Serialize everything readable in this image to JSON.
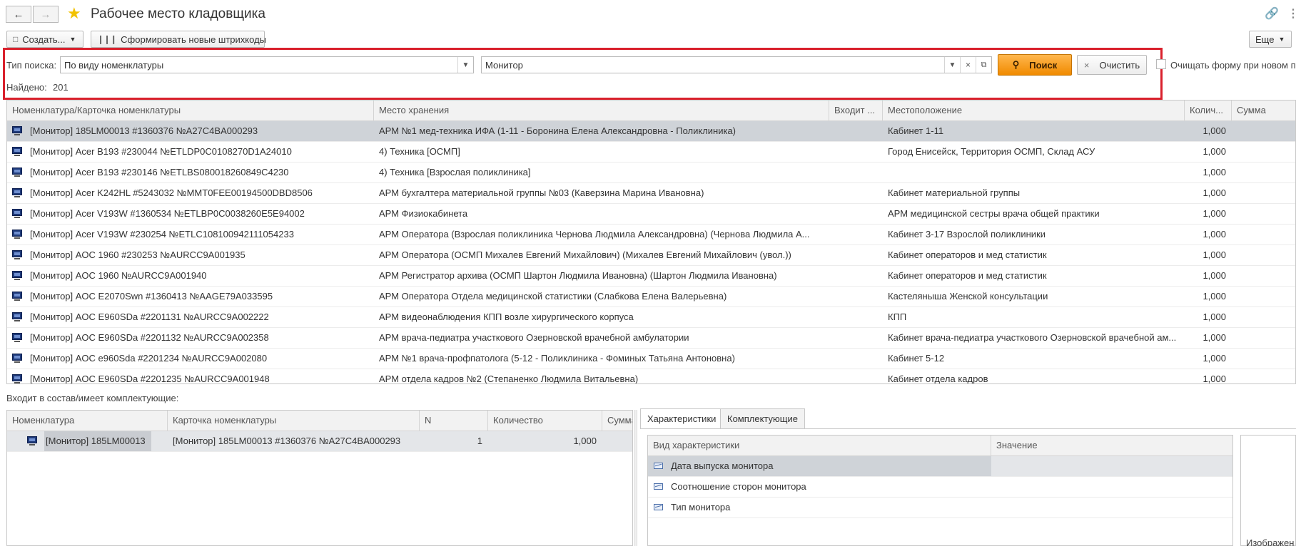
{
  "window": {
    "title": "Рабочее место кладовщика"
  },
  "toolbar": {
    "create_label": "Создать...",
    "barcodes_label": "Сформировать новые штрихкоды",
    "more_label": "Еще"
  },
  "search": {
    "type_label": "Тип поиска:",
    "type_value": "По виду номенклатуры",
    "query_value": "Монитор",
    "search_button": "Поиск",
    "clear_button": "Очистить",
    "clear_form_label": "Очищать форму при новом п",
    "found_label": "Найдено:",
    "found_count": "201"
  },
  "main_table": {
    "columns": [
      "Номенклатура/Карточка номенклатуры",
      "Место хранения",
      "Входит ...",
      "Местоположение",
      "Колич...",
      "Сумма"
    ],
    "rows": [
      {
        "item": "[Монитор] 185LM00013 #1360376 №A27C4BA000293",
        "storage": "АРМ №1 мед-техника ИФА (1-11 - Боронина Елена Александровна - Поликлиника)",
        "location": "Кабинет 1-11",
        "qty": "1,000"
      },
      {
        "item": "[Монитор] Acer B193 #230044 №ETLDP0C0108270D1A24010",
        "storage": "4) Техника [ОСМП]",
        "location": "Город Енисейск, Территория ОСМП, Склад АСУ",
        "qty": "1,000"
      },
      {
        "item": "[Монитор] Acer B193 #230146 №ETLBS080018260849C4230",
        "storage": "4) Техника [Взрослая поликлиника]",
        "location": "",
        "qty": "1,000"
      },
      {
        "item": "[Монитор] Acer K242HL #5243032 №MMT0FEE00194500DBD8506",
        "storage": "АРМ бухгалтера материальной группы №03 (Каверзина Марина Ивановна)",
        "location": "Кабинет материальной группы",
        "qty": "1,000"
      },
      {
        "item": "[Монитор] Acer V193W #1360534 №ETLBP0C0038260E5E94002",
        "storage": "АРМ Физиокабинета",
        "location": "АРМ медицинской сестры врача общей практики",
        "qty": "1,000"
      },
      {
        "item": "[Монитор] Acer V193W #230254 №ETLC108100942111054233",
        "storage": "АРМ Оператора (Взрослая поликлиника Чернова Людмила Александровна) (Чернова Людмила А...",
        "location": "Кабинет 3-17 Взрослой поликлиники",
        "qty": "1,000"
      },
      {
        "item": "[Монитор] AOC 1960 #230253 №AURCC9A001935",
        "storage": "АРМ Оператора (ОСМП Михалев Евгений Михайлович) (Михалев Евгений Михайлович (увол.))",
        "location": "Кабинет операторов и мед статистик",
        "qty": "1,000"
      },
      {
        "item": "[Монитор] AOC 1960 №AURCC9A001940",
        "storage": "АРМ Регистратор архива (ОСМП Шартон Людмила Ивановна) (Шартон Людмила Ивановна)",
        "location": "Кабинет операторов и мед статистик",
        "qty": "1,000"
      },
      {
        "item": "[Монитор] AOC E2070Swn #1360413 №AAGE79A033595",
        "storage": "АРМ Оператора Отдела медицинской статистики  (Слабкова Елена Валерьевна)",
        "location": "Кастеляныша Женской консультации",
        "qty": "1,000"
      },
      {
        "item": "[Монитор] AOC E960SDa #2201131 №AURCC9A002222",
        "storage": "АРМ видеонаблюдения КПП возле хирургического корпуса",
        "location": "КПП",
        "qty": "1,000"
      },
      {
        "item": "[Монитор] AOC E960SDa #2201132 №AURCC9A002358",
        "storage": "АРМ врача-педиатра участкового Озерновской врачебной амбулатории",
        "location": "Кабинет врача-педиатра участкового Озерновской врачебной ам...",
        "qty": "1,000"
      },
      {
        "item": "[Монитор] AOC e960Sda #2201234 №AURCC9A002080",
        "storage": "АРМ №1 врача-профпатолога (5-12 - Поликлиника - Фоминых Татьяна Антоновна)",
        "location": "Кабинет 5-12",
        "qty": "1,000"
      },
      {
        "item": "[Монитор] AOC E960SDa #2201235 №AURCC9A001948",
        "storage": "АРМ отдела кадров №2 (Степаненко Людмила Витальевна)",
        "location": "Кабинет отдела кадров",
        "qty": "1,000"
      }
    ]
  },
  "composition": {
    "label": "Входит в состав/имеет комплектующие:",
    "columns": [
      "Номенклатура",
      "Карточка номенклатуры",
      "N",
      "Количество",
      "Сумма"
    ],
    "rows": [
      {
        "item": "[Монитор] 185LM00013",
        "card": "[Монитор] 185LM00013 #1360376 №A27C4BA000293",
        "n": "1",
        "qty": "1,000"
      }
    ]
  },
  "tabs": {
    "characteristics": "Характеристики",
    "components": "Комплектующие"
  },
  "characteristics": {
    "columns": [
      "Вид характеристики",
      "Значение"
    ],
    "rows": [
      {
        "name": "Дата выпуска монитора",
        "value": ""
      },
      {
        "name": "Соотношение сторон монитора",
        "value": ""
      },
      {
        "name": "Тип монитора",
        "value": ""
      }
    ]
  },
  "image_panel": {
    "label": "Изображен"
  }
}
